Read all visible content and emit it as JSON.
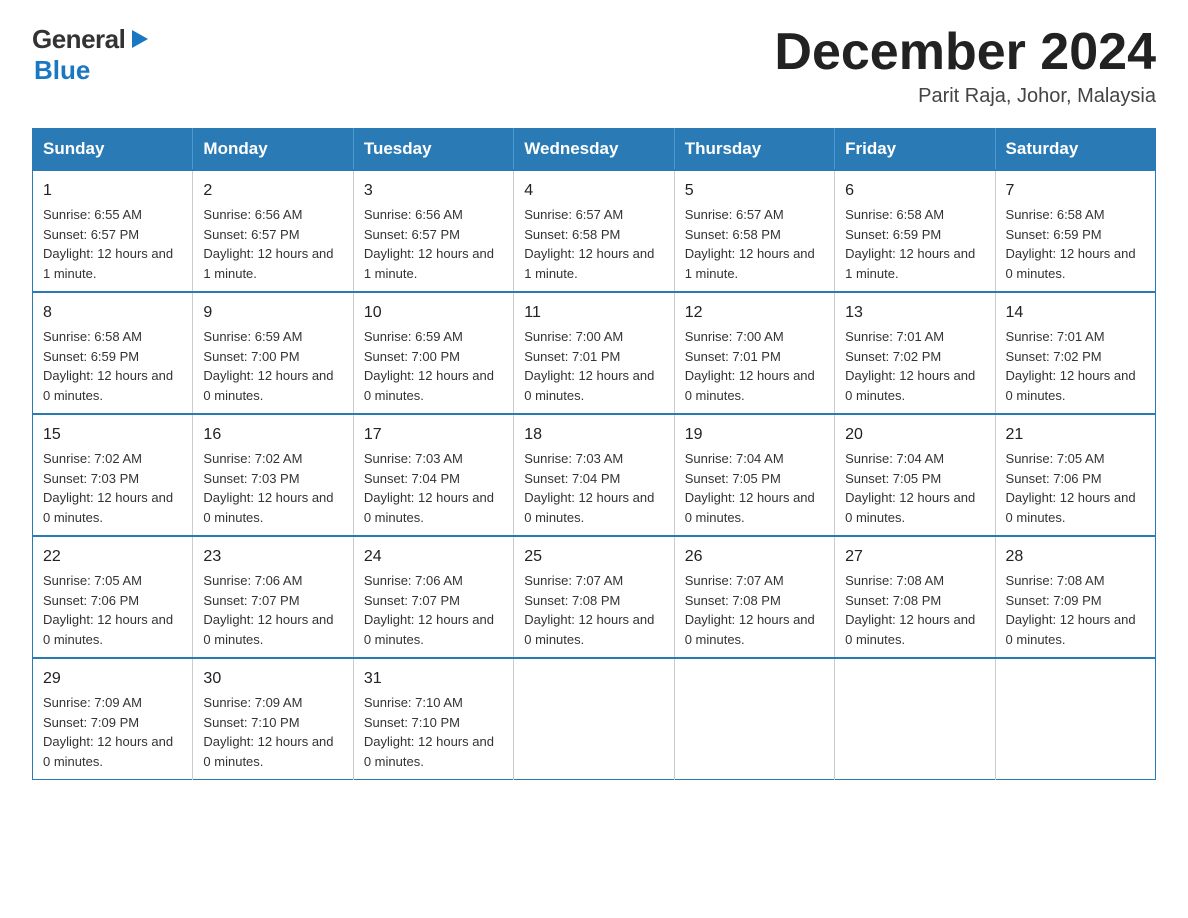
{
  "logo": {
    "text_general": "General",
    "text_blue": "Blue",
    "triangle_char": "▶"
  },
  "title": {
    "month_year": "December 2024",
    "location": "Parit Raja, Johor, Malaysia"
  },
  "days_of_week": [
    "Sunday",
    "Monday",
    "Tuesday",
    "Wednesday",
    "Thursday",
    "Friday",
    "Saturday"
  ],
  "weeks": [
    [
      {
        "num": "1",
        "sunrise": "6:55 AM",
        "sunset": "6:57 PM",
        "daylight": "12 hours and 1 minute."
      },
      {
        "num": "2",
        "sunrise": "6:56 AM",
        "sunset": "6:57 PM",
        "daylight": "12 hours and 1 minute."
      },
      {
        "num": "3",
        "sunrise": "6:56 AM",
        "sunset": "6:57 PM",
        "daylight": "12 hours and 1 minute."
      },
      {
        "num": "4",
        "sunrise": "6:57 AM",
        "sunset": "6:58 PM",
        "daylight": "12 hours and 1 minute."
      },
      {
        "num": "5",
        "sunrise": "6:57 AM",
        "sunset": "6:58 PM",
        "daylight": "12 hours and 1 minute."
      },
      {
        "num": "6",
        "sunrise": "6:58 AM",
        "sunset": "6:59 PM",
        "daylight": "12 hours and 1 minute."
      },
      {
        "num": "7",
        "sunrise": "6:58 AM",
        "sunset": "6:59 PM",
        "daylight": "12 hours and 0 minutes."
      }
    ],
    [
      {
        "num": "8",
        "sunrise": "6:58 AM",
        "sunset": "6:59 PM",
        "daylight": "12 hours and 0 minutes."
      },
      {
        "num": "9",
        "sunrise": "6:59 AM",
        "sunset": "7:00 PM",
        "daylight": "12 hours and 0 minutes."
      },
      {
        "num": "10",
        "sunrise": "6:59 AM",
        "sunset": "7:00 PM",
        "daylight": "12 hours and 0 minutes."
      },
      {
        "num": "11",
        "sunrise": "7:00 AM",
        "sunset": "7:01 PM",
        "daylight": "12 hours and 0 minutes."
      },
      {
        "num": "12",
        "sunrise": "7:00 AM",
        "sunset": "7:01 PM",
        "daylight": "12 hours and 0 minutes."
      },
      {
        "num": "13",
        "sunrise": "7:01 AM",
        "sunset": "7:02 PM",
        "daylight": "12 hours and 0 minutes."
      },
      {
        "num": "14",
        "sunrise": "7:01 AM",
        "sunset": "7:02 PM",
        "daylight": "12 hours and 0 minutes."
      }
    ],
    [
      {
        "num": "15",
        "sunrise": "7:02 AM",
        "sunset": "7:03 PM",
        "daylight": "12 hours and 0 minutes."
      },
      {
        "num": "16",
        "sunrise": "7:02 AM",
        "sunset": "7:03 PM",
        "daylight": "12 hours and 0 minutes."
      },
      {
        "num": "17",
        "sunrise": "7:03 AM",
        "sunset": "7:04 PM",
        "daylight": "12 hours and 0 minutes."
      },
      {
        "num": "18",
        "sunrise": "7:03 AM",
        "sunset": "7:04 PM",
        "daylight": "12 hours and 0 minutes."
      },
      {
        "num": "19",
        "sunrise": "7:04 AM",
        "sunset": "7:05 PM",
        "daylight": "12 hours and 0 minutes."
      },
      {
        "num": "20",
        "sunrise": "7:04 AM",
        "sunset": "7:05 PM",
        "daylight": "12 hours and 0 minutes."
      },
      {
        "num": "21",
        "sunrise": "7:05 AM",
        "sunset": "7:06 PM",
        "daylight": "12 hours and 0 minutes."
      }
    ],
    [
      {
        "num": "22",
        "sunrise": "7:05 AM",
        "sunset": "7:06 PM",
        "daylight": "12 hours and 0 minutes."
      },
      {
        "num": "23",
        "sunrise": "7:06 AM",
        "sunset": "7:07 PM",
        "daylight": "12 hours and 0 minutes."
      },
      {
        "num": "24",
        "sunrise": "7:06 AM",
        "sunset": "7:07 PM",
        "daylight": "12 hours and 0 minutes."
      },
      {
        "num": "25",
        "sunrise": "7:07 AM",
        "sunset": "7:08 PM",
        "daylight": "12 hours and 0 minutes."
      },
      {
        "num": "26",
        "sunrise": "7:07 AM",
        "sunset": "7:08 PM",
        "daylight": "12 hours and 0 minutes."
      },
      {
        "num": "27",
        "sunrise": "7:08 AM",
        "sunset": "7:08 PM",
        "daylight": "12 hours and 0 minutes."
      },
      {
        "num": "28",
        "sunrise": "7:08 AM",
        "sunset": "7:09 PM",
        "daylight": "12 hours and 0 minutes."
      }
    ],
    [
      {
        "num": "29",
        "sunrise": "7:09 AM",
        "sunset": "7:09 PM",
        "daylight": "12 hours and 0 minutes."
      },
      {
        "num": "30",
        "sunrise": "7:09 AM",
        "sunset": "7:10 PM",
        "daylight": "12 hours and 0 minutes."
      },
      {
        "num": "31",
        "sunrise": "7:10 AM",
        "sunset": "7:10 PM",
        "daylight": "12 hours and 0 minutes."
      },
      {
        "num": "",
        "sunrise": "",
        "sunset": "",
        "daylight": ""
      },
      {
        "num": "",
        "sunrise": "",
        "sunset": "",
        "daylight": ""
      },
      {
        "num": "",
        "sunrise": "",
        "sunset": "",
        "daylight": ""
      },
      {
        "num": "",
        "sunrise": "",
        "sunset": "",
        "daylight": ""
      }
    ]
  ]
}
